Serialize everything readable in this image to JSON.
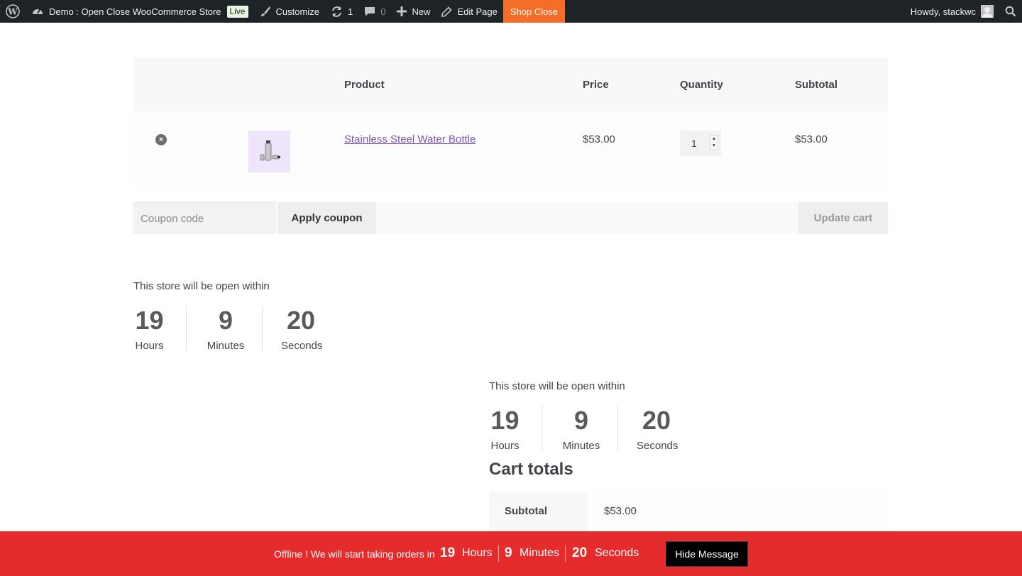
{
  "adminbar": {
    "site_name": "Demo : Open Close WooCommerce Store",
    "live_badge": "Live",
    "customize": "Customize",
    "updates_count": "1",
    "comments_count": "0",
    "new_label": "New",
    "edit_page": "Edit Page",
    "shop_close": "Shop Close",
    "howdy": "Howdy, stackwc",
    "shop_close_color": "#f56e28"
  },
  "cart": {
    "headers": {
      "product": "Product",
      "price": "Price",
      "quantity": "Quantity",
      "subtotal": "Subtotal"
    },
    "items": [
      {
        "name": "Stainless Steel Water Bottle",
        "price": "$53.00",
        "quantity": "1",
        "subtotal": "$53.00"
      }
    ],
    "remove_icon": "remove-circle-icon",
    "coupon_placeholder": "Coupon code",
    "apply_coupon": "Apply coupon",
    "update_cart": "Update cart"
  },
  "countdown_top": {
    "text": "This store will be open within",
    "hours": "19",
    "hours_label": "Hours",
    "minutes": "9",
    "minutes_label": "Minutes",
    "seconds": "20",
    "seconds_label": "Seconds"
  },
  "countdown_bottom": {
    "text": "This store will be open within",
    "hours": "19",
    "hours_label": "Hours",
    "minutes": "9",
    "minutes_label": "Minutes",
    "seconds": "20",
    "seconds_label": "Seconds"
  },
  "totals": {
    "title": "Cart totals",
    "subtotal_label": "Subtotal",
    "subtotal_value": "$53.00"
  },
  "notice": {
    "message": "Offline ! We will start taking orders in",
    "hours": "19",
    "hours_label": "Hours",
    "minutes": "9",
    "minutes_label": "Minutes",
    "seconds": "20",
    "seconds_label": "Seconds",
    "hide_button": "Hide Message",
    "bar_color": "#e52b2b"
  }
}
